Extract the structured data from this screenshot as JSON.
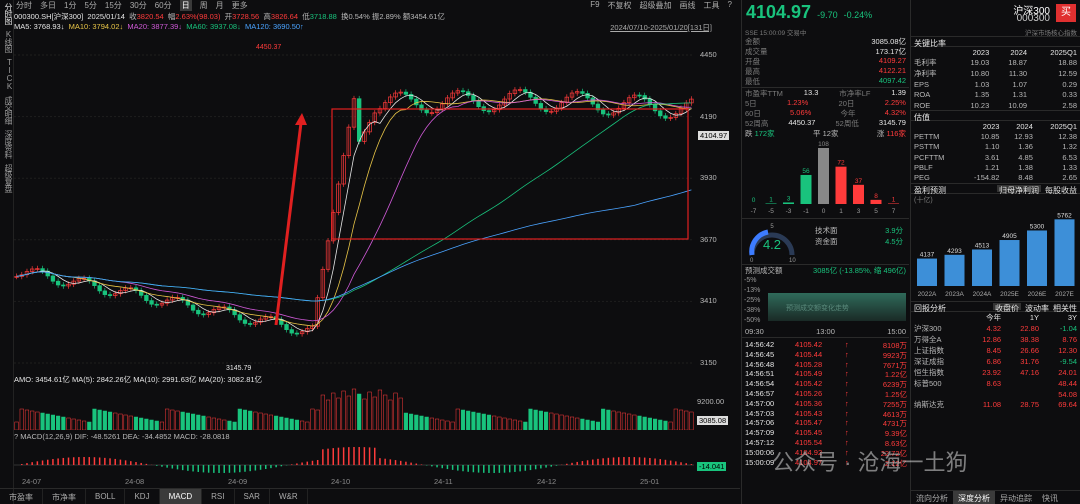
{
  "sidebar": [
    "分时图",
    "K线图",
    "TICK",
    "成交明细",
    "深度资料",
    "超级复盘"
  ],
  "topbar": {
    "periods": [
      "分时",
      "多日",
      "1分",
      "5分",
      "15分",
      "30分",
      "60分",
      "日",
      "周",
      "月",
      "更多"
    ],
    "active": "日",
    "right": [
      "F9",
      "不复权",
      "超级叠加",
      "画线",
      "工具",
      "?"
    ]
  },
  "info1": {
    "code": "000300.SH[沪深300]",
    "date": "2025/01/14",
    "close_l": "收",
    "close": "3820.54",
    "chg_l": "幅",
    "chg": "2.63%(98.03)",
    "open_l": "开",
    "open": "3728.56",
    "high_l": "高",
    "high": "3826.64",
    "low_l": "低",
    "low": "3718.88",
    "turn": "换0.54%",
    "amp": "振2.89%",
    "amt": "额3454.61亿"
  },
  "info2": {
    "ma5": "MA5: 3768.93↓",
    "ma10": "MA10: 3794.02↓",
    "ma20": "MA20: 3877.39↓",
    "ma60": "MA60: 3937.08↓",
    "ma120": "MA120: 3690.50↑",
    "range": "2024/07/10-2025/01/20[131日]"
  },
  "chart": {
    "yticks": [
      "4450",
      "4190",
      "3930",
      "3670",
      "3410",
      "3150"
    ],
    "price_tag": "4104.97",
    "max_label": "4450.37",
    "min_label": "3145.79",
    "xticks": [
      "24-07",
      "24-08",
      "24-09",
      "24-10",
      "24-11",
      "24-12",
      "25-01"
    ]
  },
  "vol": {
    "line": "AMO: 3454.61亿 MA(5): 2842.26亿 MA(10): 2991.63亿 MA(20): 3082.81亿",
    "ytop": "9200.00",
    "tag": "3085.08"
  },
  "macd": {
    "line": "? MACD(12,26,9) DIF: -48.5261 DEA: -34.4852 MACD: -28.0818",
    "tag": "-14.041"
  },
  "bottom_tabs": [
    "市盈率",
    "市净率",
    "BOLL",
    "KDJ",
    "MACD",
    "RSI",
    "SAR",
    "W&R"
  ],
  "bottom_active": "MACD",
  "quote": {
    "price": "4104.97",
    "chg": "-9.70",
    "pct": "-0.24%",
    "name": "沪深300",
    "code": "000300",
    "status": "SSE 15:00:09 交易中",
    "tag": "沪深市场核心指数"
  },
  "stats": [
    [
      "金额",
      "3085.08亿"
    ],
    [
      "成交量",
      "173.17亿"
    ],
    [
      "开盘",
      "4109.27"
    ],
    [
      "最高",
      "4122.21"
    ],
    [
      "最低",
      "4097.42"
    ]
  ],
  "stats2": [
    [
      "市盈率TTM",
      "13.3",
      "市净率LF",
      "1.39"
    ],
    [
      "5日",
      "1.23%",
      "20日",
      "2.25%"
    ],
    [
      "60日",
      "5.06%",
      "今年",
      "4.32%"
    ],
    [
      "52周高",
      "4450.37",
      "52周低",
      "3145.79"
    ]
  ],
  "breadth": {
    "down": "跌",
    "down_n": "172家",
    "flat": "平",
    "flat_n": "12家",
    "up": "涨",
    "up_n": "116家"
  },
  "dist": {
    "labels": [
      "-7",
      "-5",
      "-3",
      "-1",
      "0",
      "1",
      "3",
      "5",
      "7"
    ],
    "values": [
      0,
      1,
      3,
      56,
      108,
      72,
      37,
      8,
      1
    ]
  },
  "score": {
    "value": "4.2",
    "min": "0",
    "mid": "5",
    "max": "10",
    "tech_l": "技术面",
    "tech": "3.9分",
    "fund_l": "资金面",
    "fund": "4.5分"
  },
  "forecast": {
    "label": "预测成交额",
    "value": "3085亿 (-13.85%, 缩 496亿)",
    "levels": [
      "-5%",
      "-13%",
      "-25%",
      "-38%",
      "-50%"
    ],
    "watermark": "预测成交额变化走势",
    "times": [
      "09:30",
      "13:00",
      "15:00"
    ]
  },
  "trades": [
    [
      "14:56:42",
      "4105.42",
      "8108万"
    ],
    [
      "14:56:45",
      "4105.44",
      "9923万"
    ],
    [
      "14:56:48",
      "4105.28",
      "7671万"
    ],
    [
      "14:56:51",
      "4105.49",
      "1.22亿"
    ],
    [
      "14:56:54",
      "4105.42",
      "6239万"
    ],
    [
      "14:56:57",
      "4105.26",
      "1.25亿"
    ],
    [
      "14:57:00",
      "4105.36",
      "7255万"
    ],
    [
      "14:57:03",
      "4105.43",
      "4613万"
    ],
    [
      "14:57:06",
      "4105.47",
      "4731万"
    ],
    [
      "14:57:09",
      "4105.45",
      "9.39亿"
    ],
    [
      "14:57:12",
      "4105.54",
      "8.63亿"
    ],
    [
      "15:00:06",
      "4104.92",
      "22.72亿"
    ],
    [
      "15:00:09",
      "4104.97",
      "2.12亿"
    ]
  ],
  "ratios": {
    "title": "关键比率",
    "cols": [
      "2023",
      "2024",
      "2025Q1"
    ],
    "rows": [
      [
        "毛利率",
        "19.03",
        "18.87",
        "18.88"
      ],
      [
        "净利率",
        "10.80",
        "11.30",
        "12.59"
      ],
      [
        "EPS",
        "1.03",
        "1.07",
        "0.29"
      ],
      [
        "ROA",
        "1.35",
        "1.31",
        "0.33"
      ],
      [
        "ROE",
        "10.23",
        "10.09",
        "2.58"
      ]
    ]
  },
  "val": {
    "title": "估值",
    "rows": [
      [
        "PETTM",
        "10.85",
        "12.93",
        "12.38"
      ],
      [
        "PSTTM",
        "1.10",
        "1.36",
        "1.32"
      ],
      [
        "PCFTTM",
        "3.61",
        "4.85",
        "6.53"
      ],
      [
        "PBLF",
        "1.21",
        "1.38",
        "1.33"
      ],
      [
        "PEG",
        "-154.82",
        "8.48",
        "2.65"
      ]
    ]
  },
  "profit": {
    "title": "盈利预测",
    "unit": "(十亿)",
    "btn1": "归母净利润",
    "btn2": "每股收益",
    "chart_data": {
      "type": "bar",
      "categories": [
        "2022A",
        "2023A",
        "2024A",
        "2025E",
        "2026E",
        "2027E"
      ],
      "values": [
        4137,
        4293,
        4513,
        4905,
        5300,
        5762
      ]
    }
  },
  "returns": {
    "title": "回报分析",
    "btn1": "收盘价",
    "btn2": "波动率",
    "btn3": "相关性",
    "cols": [
      "今年",
      "1Y",
      "3Y"
    ],
    "rows": [
      [
        "沪深300",
        "4.32",
        "22.80",
        "-1.04"
      ],
      [
        "万得全A",
        "12.86",
        "38.38",
        "8.76"
      ],
      [
        "上证指数",
        "8.45",
        "26.66",
        "12.30"
      ],
      [
        "深证成指",
        "6.86",
        "31.76",
        "-9.54"
      ],
      [
        "恒生指数",
        "23.92",
        "47.16",
        "24.01"
      ],
      [
        "标普500",
        "8.63",
        "",
        "48.44"
      ],
      [
        "",
        "",
        "",
        "54.08"
      ],
      [
        "纳斯达克",
        "11.08",
        "28.75",
        "69.64"
      ]
    ]
  },
  "right_tabs": [
    "流向分析",
    "深度分析",
    "异动追踪",
    "快讯"
  ],
  "right_active": "深度分析",
  "header_right": {
    "name": "沪深300",
    "code": "000300",
    "buy": "买"
  },
  "watermark": "公众号 · 沧海一土狗",
  "colors": {
    "up": "#ff3b3b",
    "down": "#19c37d",
    "bg": "#0d0d0f"
  }
}
